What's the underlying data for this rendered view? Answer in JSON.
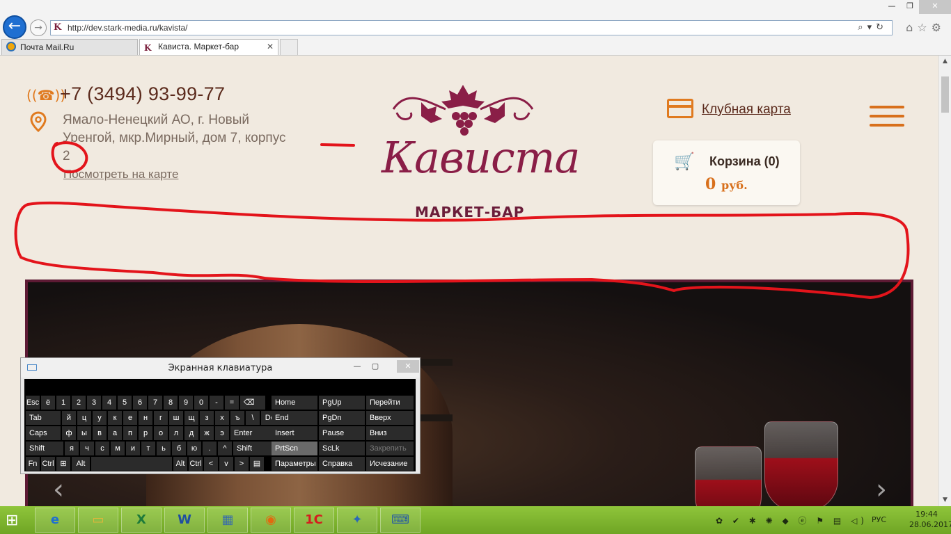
{
  "browser": {
    "url": "http://dev.stark-media.ru/kavista/",
    "tabs": [
      {
        "label": "Почта Mail.Ru"
      },
      {
        "label": "Кависта. Маркет-бар"
      }
    ],
    "tab_close": "✕"
  },
  "header": {
    "phone": "+7 (3494) 93-99-77",
    "address_line1": "Ямало-Ненецкий АО, г. Новый",
    "address_line2": "Уренгой, мкр.Мирный, дом 7, корпус",
    "address_line3": "2",
    "map_link": "Посмотреть на карте",
    "club_card": "Клубная карта",
    "cart_title": "Корзина (0)",
    "cart_sum": "0",
    "cart_currency": "руб."
  },
  "logo": {
    "name": "Кависта",
    "subtitle": "МАРКЕТ-БАР"
  },
  "osk": {
    "title": "Экранная клавиатура",
    "row1": [
      "Esc",
      "ё",
      "1",
      "2",
      "3",
      "4",
      "5",
      "6",
      "7",
      "8",
      "9",
      "0",
      "-",
      "=",
      "⌫"
    ],
    "row2": [
      "Tab",
      "й",
      "ц",
      "у",
      "к",
      "е",
      "н",
      "г",
      "ш",
      "щ",
      "з",
      "х",
      "ъ",
      "\\",
      "Del"
    ],
    "row3": [
      "Caps",
      "ф",
      "ы",
      "в",
      "а",
      "п",
      "р",
      "о",
      "л",
      "д",
      "ж",
      "э",
      "Enter"
    ],
    "row4": [
      "Shift",
      "я",
      "ч",
      "с",
      "м",
      "и",
      "т",
      "ь",
      "б",
      "ю",
      ".",
      "^",
      "Shift"
    ],
    "row5": [
      "Fn",
      "Ctrl",
      "⊞",
      "Alt",
      "",
      "Alt",
      "Ctrl",
      "<",
      "v",
      ">",
      "▤"
    ],
    "side": [
      [
        "Home",
        "PgUp",
        "Перейти"
      ],
      [
        "End",
        "PgDn",
        "Вверх"
      ],
      [
        "Insert",
        "Pause",
        "Вниз"
      ],
      [
        "PrtScn",
        "ScLk",
        "Закрепить"
      ],
      [
        "Параметры",
        "Справка",
        "Исчезание"
      ]
    ]
  },
  "taskbar": {
    "lang": "РУС",
    "time": "19:44",
    "date": "28.06.2017"
  },
  "colors": {
    "accent_orange": "#e07a1f",
    "brand_wine": "#8a1e47",
    "taskbar_green": "#7db32e",
    "annotation_red": "#e3141b"
  }
}
